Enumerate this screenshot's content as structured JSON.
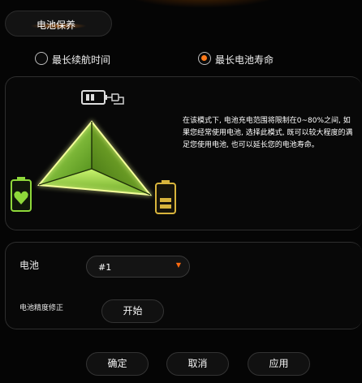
{
  "header": {
    "section_title": "电池保养"
  },
  "modes": {
    "options": [
      {
        "label": "最长续航时间",
        "checked": false
      },
      {
        "label": "最长电池寿命",
        "checked": true
      }
    ]
  },
  "panel": {
    "description": "在该模式下, 电池充电范围将限制在0~80%之间, 如果您经常使用电池, 选择此模式, 既可以较大程度的满足您使用电池, 也可以延长您的电池寿命。"
  },
  "battery": {
    "label": "电池",
    "selected": "#1",
    "calibration_label": "电池精度修正",
    "start_label": "开始"
  },
  "footer": {
    "ok_label": "确定",
    "cancel_label": "取消",
    "apply_label": "应用"
  },
  "colors": {
    "accent": "#ff7a1a",
    "green": "#8ed83a",
    "gold": "#d8b43c"
  },
  "icons": [
    "plug-battery-icon",
    "heart-battery-icon",
    "full-battery-icon",
    "dropdown-arrow-icon"
  ]
}
